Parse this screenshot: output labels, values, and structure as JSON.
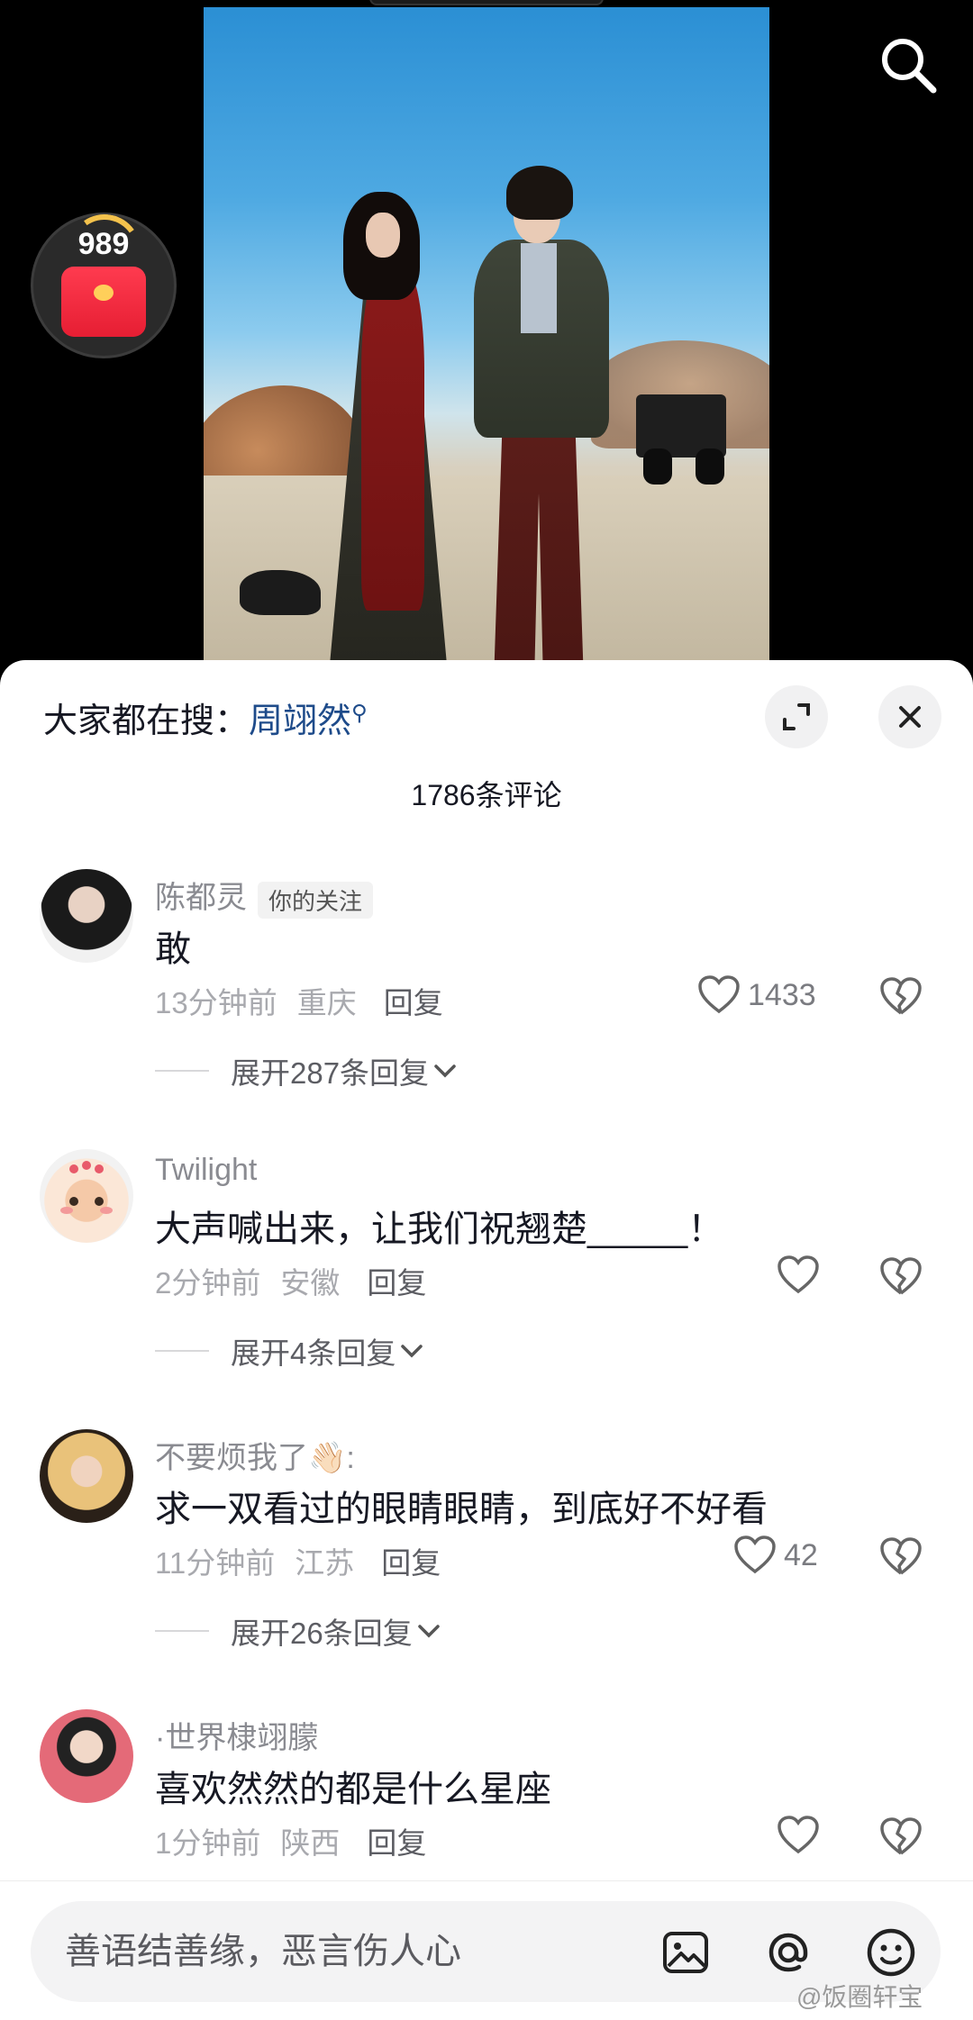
{
  "top": {
    "redpack_count": "989"
  },
  "sheet": {
    "hot_search_prefix": "大家都在搜：",
    "hot_search_keyword": "周翊然",
    "comment_count": "1786条评论"
  },
  "comments": [
    {
      "username": "陈都灵",
      "tag": "你的关注",
      "text": "敢",
      "time": "13分钟前",
      "location": "重庆",
      "reply_label": "回复",
      "likes": "1433",
      "expand_label": "展开287条回复"
    },
    {
      "username": "Twilight",
      "tag": "",
      "text": "大声喊出来，让我们祝翘楚_____！",
      "time": "2分钟前",
      "location": "安徽",
      "reply_label": "回复",
      "likes": "",
      "expand_label": "展开4条回复"
    },
    {
      "username": "不要烦我了👋🏻:",
      "tag": "",
      "text": "求一双看过的眼睛眼睛，到底好不好看",
      "time": "11分钟前",
      "location": "江苏",
      "reply_label": "回复",
      "likes": "42",
      "expand_label": "展开26条回复"
    },
    {
      "username": "·世界棣翊朦",
      "tag": "",
      "text": "喜欢然然的都是什么星座",
      "time": "1分钟前",
      "location": "陕西",
      "reply_label": "回复",
      "likes": "",
      "expand_label": ""
    }
  ],
  "input": {
    "placeholder": "善语结善缘，恶言伤人心"
  },
  "watermark": "@饭圈轩宝",
  "icons": {
    "search": "search-icon",
    "expand": "expand-icon",
    "close": "close-icon",
    "like": "heart-icon",
    "dislike": "broken-heart-icon",
    "image": "image-icon",
    "mention": "at-icon",
    "emoji": "emoji-icon"
  },
  "colors": {
    "keyword": "#1e4b8a",
    "redpack": "#e61e33",
    "meta_text": "#a8a9ae"
  }
}
